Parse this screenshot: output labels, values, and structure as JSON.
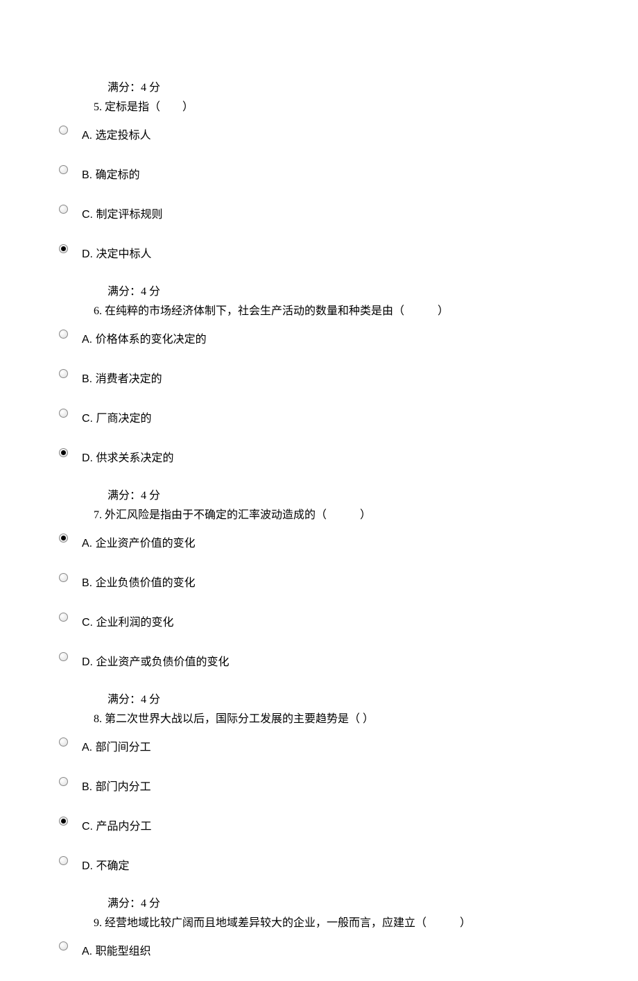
{
  "score_prefix": "满分：",
  "score_value": "4",
  "score_suffix": " 分",
  "questions": [
    {
      "num": "5",
      "text": "定标是指（　　）",
      "selected": 3,
      "options": [
        {
          "letter": "A",
          "text": "选定投标人"
        },
        {
          "letter": "B",
          "text": "确定标的"
        },
        {
          "letter": "C",
          "text": "制定评标规则"
        },
        {
          "letter": "D",
          "text": "决定中标人"
        }
      ]
    },
    {
      "num": "6",
      "text": "在纯粹的市场经济体制下，社会生产活动的数量和种类是由（　　　）",
      "selected": 3,
      "options": [
        {
          "letter": "A",
          "text": "价格体系的变化决定的"
        },
        {
          "letter": "B",
          "text": "消费者决定的"
        },
        {
          "letter": "C",
          "text": "厂商决定的"
        },
        {
          "letter": "D",
          "text": "供求关系决定的"
        }
      ]
    },
    {
      "num": "7",
      "text": "外汇风险是指由于不确定的汇率波动造成的（　　　）",
      "selected": 0,
      "options": [
        {
          "letter": "A",
          "text": "企业资产价值的变化"
        },
        {
          "letter": "B",
          "text": "企业负债价值的变化"
        },
        {
          "letter": "C",
          "text": "企业利润的变化"
        },
        {
          "letter": "D",
          "text": "企业资产或负债价值的变化"
        }
      ]
    },
    {
      "num": "8",
      "text": "第二次世界大战以后，国际分工发展的主要趋势是（ ）",
      "selected": 2,
      "options": [
        {
          "letter": "A",
          "text": "部门间分工"
        },
        {
          "letter": "B",
          "text": "部门内分工"
        },
        {
          "letter": "C",
          "text": "产品内分工"
        },
        {
          "letter": "D",
          "text": "不确定"
        }
      ]
    },
    {
      "num": "9",
      "text": "经营地域比较广阔而且地域差异较大的企业，一般而言，应建立（　　　）",
      "selected": -1,
      "options": [
        {
          "letter": "A",
          "text": "职能型组织"
        }
      ]
    }
  ]
}
